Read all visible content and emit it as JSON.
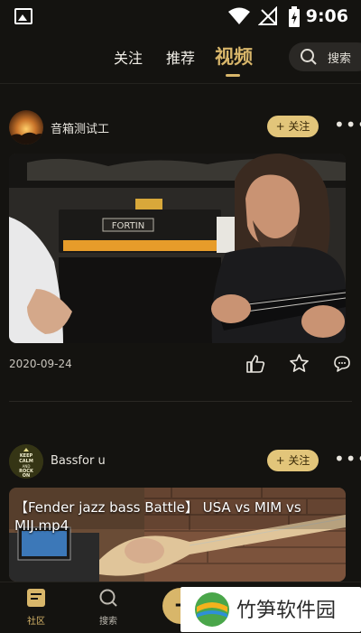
{
  "status_bar": {
    "time": "9:06"
  },
  "top_nav": {
    "tabs": [
      {
        "label": "关注",
        "active": false
      },
      {
        "label": "推荐",
        "active": false
      },
      {
        "label": "视频",
        "active": true
      }
    ],
    "search_label": "搜索"
  },
  "posts": [
    {
      "username": "音箱测试工",
      "follow_label": "+ 关注",
      "date": "2020-09-24",
      "amp_brand": "FORTIN"
    },
    {
      "username": "Bassfor u",
      "follow_label": "+ 关注",
      "avatar_text": "KEEP CALM AND ROCK ON",
      "video_title": "【Fender jazz bass Battle】 USA vs MIM vs MIJ.mp4"
    }
  ],
  "bottom_nav": {
    "items": [
      {
        "label": "社区",
        "active": true
      },
      {
        "label": "搜索",
        "active": false
      }
    ]
  },
  "watermark": {
    "text": "竹笋软件园"
  },
  "colors": {
    "accent": "#d8b66a",
    "background": "#141310",
    "follow_bg": "#e2c57a"
  }
}
